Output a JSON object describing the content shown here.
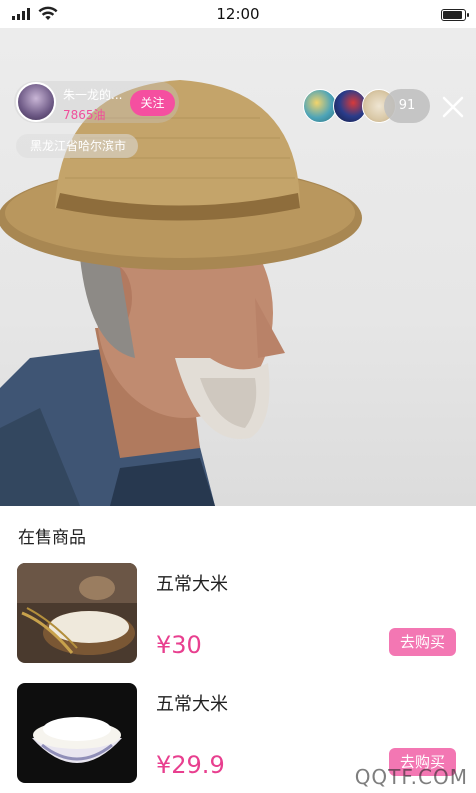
{
  "status_bar": {
    "time": "12:00"
  },
  "host": {
    "name": "朱一龙的...",
    "likes": "7865油",
    "follow_label": "关注",
    "location": "黑龙江省哈尔滨市"
  },
  "viewers": {
    "count": "91"
  },
  "products": {
    "section_title": "在售商品",
    "items": [
      {
        "name": "五常大米",
        "price": "¥30",
        "buy_label": "去购买"
      },
      {
        "name": "五常大米",
        "price": "¥29.9",
        "buy_label": "去购买"
      }
    ]
  },
  "watermark": "QQTF.COM",
  "colors": {
    "accent": "#f54fa0",
    "price": "#e83f8f",
    "buy_button": "#f377b3"
  }
}
